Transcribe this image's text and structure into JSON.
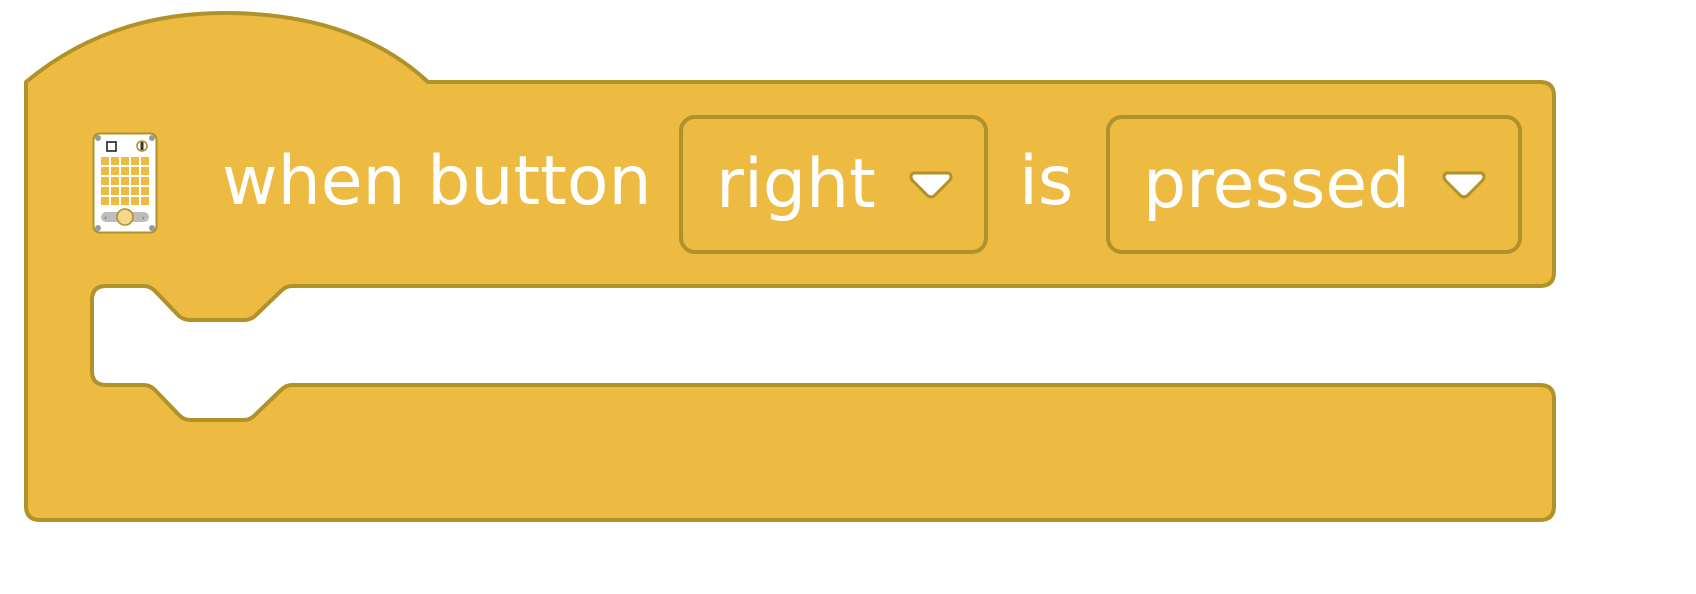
{
  "block": {
    "category_color": "#EDBB41",
    "border_color": "#B0912A",
    "icon": "microbit-device-icon",
    "prefix_label": "when button",
    "button_dropdown": {
      "selected": "right",
      "icon": "dropdown-arrow-icon"
    },
    "connector_label": "is",
    "state_dropdown": {
      "selected": "pressed",
      "icon": "dropdown-arrow-icon"
    }
  }
}
